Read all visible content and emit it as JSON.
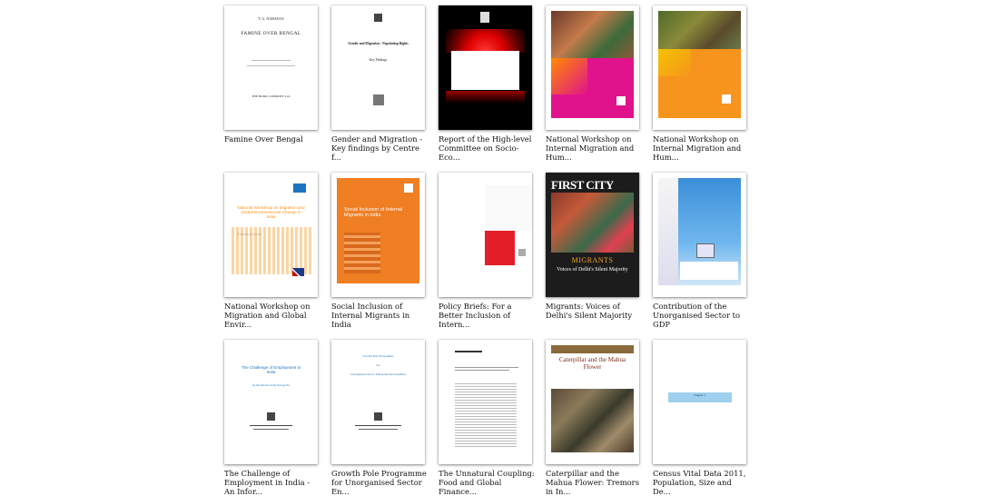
{
  "books": [
    {
      "title": "Famine Over Bengal",
      "cover_lines": [
        "T. G. NARAYAN",
        "FAMINE OVER BENGAL",
        "THE BOOK COMPANY, Ltd."
      ]
    },
    {
      "title": "Gender and Migration - Key findings by Centre f...",
      "cover_lines": [
        "Gender and Migration : Negotiating Rights",
        "Key Findings"
      ]
    },
    {
      "title": "Report of the High-level Committee on Socio-Eco...",
      "cover_lines": []
    },
    {
      "title": "National Workshop on Internal Migration and Hum...",
      "cover_lines": []
    },
    {
      "title": "National Workshop on Internal Migration and Hum...",
      "cover_lines": []
    },
    {
      "title": "National Workshop on Migration and Global Envir...",
      "cover_lines": [
        "National Workshop on Migration and Global Environmental Change in India",
        "Summary Report"
      ]
    },
    {
      "title": "Social Inclusion of Internal Migrants in India",
      "cover_lines": [
        "Social Inclusion of Internal Migrants in India"
      ]
    },
    {
      "title": "Policy Briefs: For a Better Inclusion of Intern...",
      "cover_lines": []
    },
    {
      "title": "Migrants: Voices of Delhi's Silent Majority",
      "cover_lines": [
        "FIRST CITY",
        "MIGRANTS",
        "Voices of Delhi's Silent Majority"
      ]
    },
    {
      "title": "Contribution of the Unorganised Sector to GDP",
      "cover_lines": []
    },
    {
      "title": "The Challenge of Employment in India - An Infor...",
      "cover_lines": [
        "The Challenge of Employment in India",
        "An Informal Economy Perspective"
      ]
    },
    {
      "title": "Growth Pole Programme for Unorganised Sector En...",
      "cover_lines": [
        "Growth Pole Programme",
        "for",
        "Unorganised Sector Enterprise Development"
      ]
    },
    {
      "title": "The Unnatural Coupling: Food and Global Finance...",
      "cover_lines": []
    },
    {
      "title": "Caterpillar and the Mahua Flower: Tremors in In...",
      "cover_lines": [
        "Caterpillar and the Mahua Flower"
      ]
    },
    {
      "title": "Census Vital Data 2011, Population, Size and De...",
      "cover_lines": [
        "Chapter 1"
      ]
    }
  ]
}
